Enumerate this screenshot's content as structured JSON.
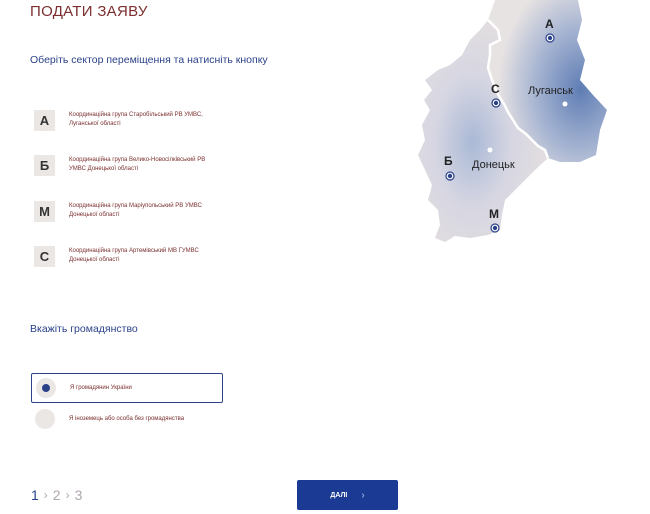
{
  "page": {
    "title": "ПОДАТИ ЗАЯВУ"
  },
  "sectors": {
    "prompt": "Оберіть сектор переміщення та натисніть кнопку",
    "items": [
      {
        "letter": "А",
        "text": "Координаційна група Старобільський РВ УМВС, Луганської області"
      },
      {
        "letter": "Б",
        "text": "Координаційна група Велико-Новосілківський РВ УМВС Донецької області"
      },
      {
        "letter": "М",
        "text": "Координаційна група Маріупольський РВ УМВС Донецької області"
      },
      {
        "letter": "С",
        "text": "Координаційна група Артемівський МВ ГУМВС Донецької області"
      }
    ]
  },
  "citizenship": {
    "prompt": "Вкажіть громадянство",
    "options": [
      {
        "label": "Я громадянин України",
        "selected": true
      },
      {
        "label": "Я іноземець або особа без громадянства",
        "selected": false
      }
    ]
  },
  "steps": {
    "items": [
      "1",
      "2",
      "3"
    ],
    "current": "1",
    "separator": "›"
  },
  "next_button": {
    "label": "ДАЛІ",
    "chevron": "›"
  },
  "map": {
    "city_lugansk": "Луганськ",
    "city_donetsk": "Донецьк",
    "marker_a": "А",
    "marker_c": "С",
    "marker_b": "Б",
    "marker_m": "М"
  },
  "colors": {
    "accent": "#1a3a93",
    "title": "#7b2f2f",
    "link": "#2b4289"
  }
}
